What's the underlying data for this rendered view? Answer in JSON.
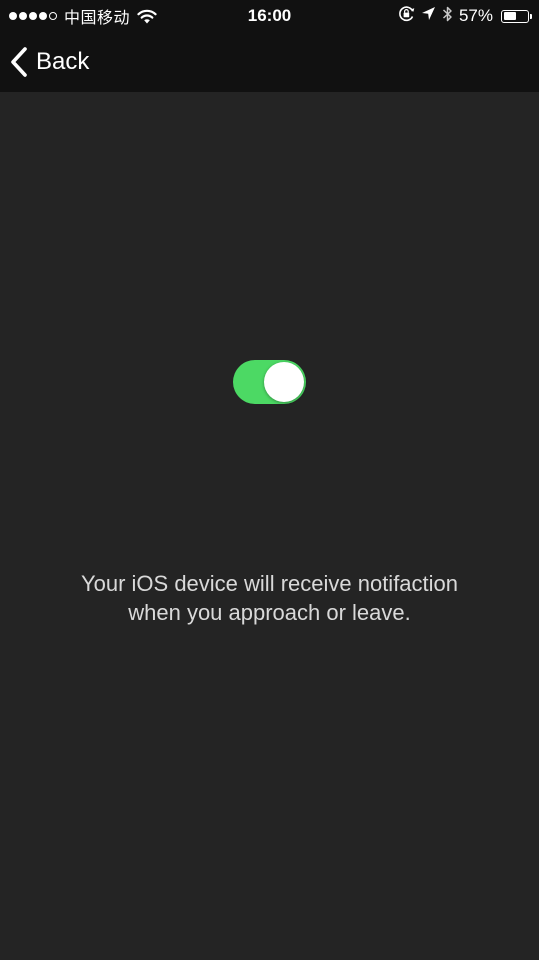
{
  "status_bar": {
    "carrier": "中国移动",
    "time": "16:00",
    "battery_percent": "57%",
    "battery_level": 0.57,
    "signal_bars_filled": 4,
    "signal_bars_total": 5,
    "icons": [
      "wifi-icon",
      "rotation-lock-icon",
      "location-arrow-icon",
      "bluetooth-icon",
      "battery-icon"
    ]
  },
  "nav": {
    "back_label": "Back"
  },
  "toggle": {
    "on": true,
    "on_color": "#4cd964"
  },
  "message": {
    "line1": "Your iOS device will receive notifaction",
    "line2": "when you approach or leave."
  },
  "colors": {
    "background": "#242424",
    "bar_background": "#111111",
    "text": "#ffffff",
    "message_text": "#d9d9d9"
  }
}
